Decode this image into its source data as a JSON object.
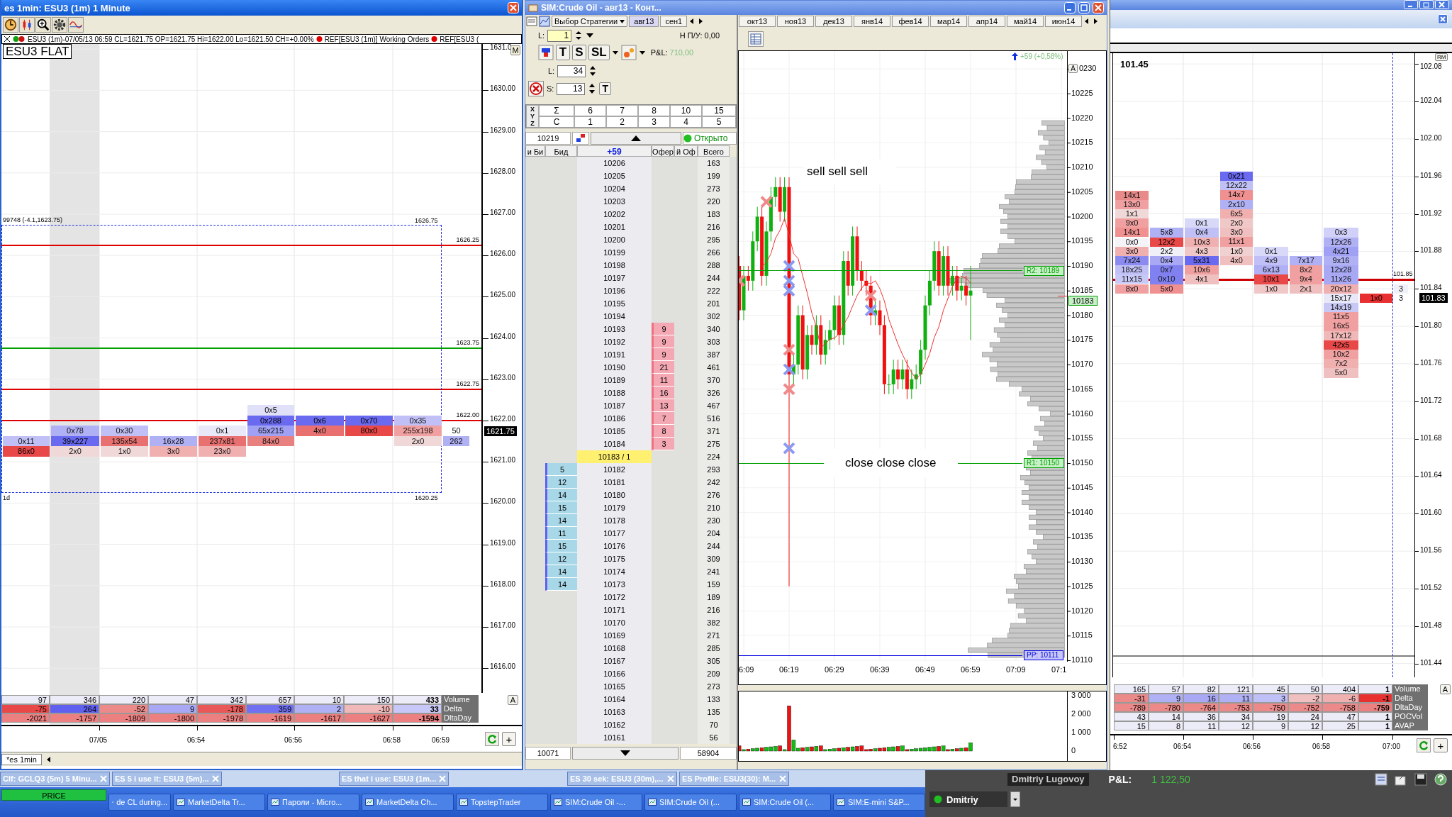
{
  "left_window": {
    "title": "es 1min: ESU3 (1m) 1 Minute",
    "info_line": "ESU3 (1m)-07/05/13 06:59 CL=1621.75 OP=1621.75 Hi=1622.00 Lo=1621.50 CH=+0.00%",
    "info_refs": [
      "REF[ESU3 (1m)] Working Orders",
      "REF[ESU3 ("
    ],
    "position_label": "ESU3 FLAT",
    "axis_button": "M",
    "price_axis": [
      "1631.0",
      "1630.00",
      "1629.00",
      "1628.00",
      "1627.00",
      "1626.00",
      "1625.00",
      "1624.00",
      "1623.00",
      "1622.00",
      "1621.00",
      "1620.00",
      "1619.00",
      "1618.00",
      "1617.00",
      "1616.00"
    ],
    "levels": [
      {
        "price": "1626.25",
        "color": "#e00000"
      },
      {
        "price": "1623.75",
        "color": "#00a000"
      },
      {
        "price": "1622.75",
        "color": "#e00000"
      },
      {
        "price": "1622.00",
        "color": "#e00000"
      }
    ],
    "range_box": {
      "note": "99748 (-4.1,1623.75)",
      "high": "1626.75",
      "low": "1620.25",
      "period": "1d"
    },
    "columns": [
      {
        "cells": [
          {
            "text": "0x11",
            "color": "#c0c0f6"
          },
          {
            "text": "86x0",
            "color": "#e84848"
          }
        ]
      },
      {
        "cells": [
          {
            "text": "0x78",
            "color": "#b0b0f4"
          },
          {
            "text": "39x227",
            "color": "#6a6af0"
          },
          {
            "text": "2x0",
            "color": "#f0d8d8"
          }
        ]
      },
      {
        "cells": [
          {
            "text": "0x30",
            "color": "#c0c0f6"
          },
          {
            "text": "135x54",
            "color": "#e87070"
          },
          {
            "text": "1x0",
            "color": "#f0d8d8"
          }
        ]
      },
      {
        "cells": [
          {
            "text": "16x28",
            "color": "#b0b0f4"
          },
          {
            "text": "3x0",
            "color": "#f0b0b0"
          }
        ]
      },
      {
        "cells": [
          {
            "text": "0x1",
            "color": "#e8e8f8"
          },
          {
            "text": "237x81",
            "color": "#e87070"
          },
          {
            "text": "23x0",
            "color": "#f0b0b0"
          }
        ]
      },
      {
        "cells": [
          {
            "text": "0x5",
            "color": "#e0e0f8"
          },
          {
            "text": "0x288",
            "color": "#6a6af0"
          },
          {
            "text": "65x215",
            "color": "#a0a0f4"
          },
          {
            "text": "84x0",
            "color": "#e88080"
          }
        ]
      },
      {
        "cells": [
          {
            "text": "0x6",
            "color": "#6a6af0"
          },
          {
            "text": "4x0",
            "color": "#e87070"
          }
        ]
      },
      {
        "cells": [
          {
            "text": "0x70",
            "color": "#6a6af0"
          },
          {
            "text": "80x0",
            "color": "#e84848"
          }
        ]
      },
      {
        "cells": [
          {
            "text": "0x35",
            "color": "#c0c0f6"
          },
          {
            "text": "255x198",
            "color": "#f0a0a0"
          },
          {
            "text": "2x0",
            "color": "#f0d8d8"
          }
        ]
      },
      {
        "cells": [
          {
            "text": "50",
            "color": "#ffffff"
          },
          {
            "text": "262",
            "color": "#b0b0f4"
          }
        ]
      }
    ],
    "last_price": "1621.75",
    "stats": [
      {
        "label": "Volume",
        "kind": "plain",
        "cells": [
          "97",
          "346",
          "220",
          "47",
          "342",
          "657",
          "10",
          "150",
          "433"
        ]
      },
      {
        "label": "Delta",
        "kind": "colored",
        "cells": [
          {
            "text": "-75",
            "color": "#e84848"
          },
          {
            "text": "264",
            "color": "#6060f0"
          },
          {
            "text": "-52",
            "color": "#ec8a8a"
          },
          {
            "text": "9",
            "color": "#a8a8f4"
          },
          {
            "text": "-178",
            "color": "#e85858"
          },
          {
            "text": "359",
            "color": "#7070f0"
          },
          {
            "text": "2",
            "color": "#b0b0f4"
          },
          {
            "text": "-10",
            "color": "#f0b8b8"
          },
          {
            "text": "33",
            "color": "#c8c8f8"
          }
        ]
      },
      {
        "label": "DltaDay",
        "kind": "colored",
        "cells": [
          {
            "text": "-2021",
            "color": "#ec8080"
          },
          {
            "text": "-1757",
            "color": "#ec8080"
          },
          {
            "text": "-1809",
            "color": "#ec8080"
          },
          {
            "text": "-1800",
            "color": "#ec8080"
          },
          {
            "text": "-1978",
            "color": "#ec8080"
          },
          {
            "text": "-1619",
            "color": "#ec8080"
          },
          {
            "text": "-1617",
            "color": "#ec8080"
          },
          {
            "text": "-1627",
            "color": "#ec8080"
          },
          {
            "text": "-1594",
            "color": "#ec8080"
          }
        ]
      }
    ],
    "auto_button": "A",
    "time_axis": [
      "07/05",
      "06:54",
      "06:56",
      "06:58",
      "06:59"
    ],
    "add_button": "+",
    "tab": "*es 1min"
  },
  "crude_window": {
    "title": "SIM:Crude Oil - авг13 - Конт...",
    "strategy": "Выбор Стратегии",
    "contract_tabs": [
      {
        "label": "авг13",
        "selected": true
      },
      {
        "label": "сен1",
        "selected": false
      }
    ],
    "lots_label": "L:",
    "lots": "1",
    "pl_open": "Н П/У: 0,00",
    "pl_label": "P&L:",
    "pl_value": "710,00",
    "order_buttons": [
      "T",
      "S",
      "SL"
    ],
    "limit_label": "L:",
    "limit": "34",
    "stop_label": "S:",
    "stop": "13",
    "t_button": "T",
    "grid": {
      "row_labels": [
        "X",
        "Y",
        "Z"
      ],
      "row1": [
        "Σ",
        "6",
        "7",
        "8",
        "10",
        "15"
      ],
      "row2": [
        "C",
        "1",
        "2",
        "3",
        "4",
        "5"
      ]
    },
    "last": "10219",
    "status": "Открыто",
    "headers": [
      "и Би",
      "Бид",
      "+59",
      "Офер",
      "й Оф",
      "Всего"
    ],
    "rows": [
      {
        "kind": "level",
        "price": "10206",
        "volume": "163"
      },
      {
        "kind": "level",
        "price": "10205",
        "volume": "199"
      },
      {
        "kind": "level",
        "price": "10204",
        "volume": "273"
      },
      {
        "kind": "level",
        "price": "10203",
        "volume": "220"
      },
      {
        "kind": "level",
        "price": "10202",
        "volume": "183"
      },
      {
        "kind": "level",
        "price": "10201",
        "volume": "216"
      },
      {
        "kind": "level",
        "price": "10200",
        "volume": "295"
      },
      {
        "kind": "level",
        "price": "10199",
        "volume": "266"
      },
      {
        "kind": "level",
        "price": "10198",
        "volume": "288"
      },
      {
        "kind": "level",
        "price": "10197",
        "volume": "244"
      },
      {
        "kind": "level",
        "price": "10196",
        "volume": "222"
      },
      {
        "kind": "level",
        "price": "10195",
        "volume": "201"
      },
      {
        "kind": "level",
        "price": "10194",
        "volume": "302"
      },
      {
        "kind": "level",
        "price": "10193",
        "offer": "9",
        "volume": "340"
      },
      {
        "kind": "level",
        "price": "10192",
        "offer": "9",
        "volume": "303"
      },
      {
        "kind": "level",
        "price": "10191",
        "offer": "9",
        "volume": "387"
      },
      {
        "kind": "level",
        "price": "10190",
        "offer": "21",
        "volume": "461"
      },
      {
        "kind": "level",
        "price": "10189",
        "offer": "11",
        "volume": "370"
      },
      {
        "kind": "level",
        "price": "10188",
        "offer": "16",
        "volume": "326"
      },
      {
        "kind": "level",
        "price": "10187",
        "offer": "13",
        "volume": "467"
      },
      {
        "kind": "level",
        "price": "10186",
        "offer": "7",
        "volume": "516"
      },
      {
        "kind": "level",
        "price": "10185",
        "offer": "8",
        "volume": "371"
      },
      {
        "kind": "level",
        "price": "10184",
        "offer": "3",
        "volume": "275"
      },
      {
        "kind": "last",
        "price": "10183 / 1",
        "volume": "224"
      },
      {
        "kind": "level",
        "price": "10182",
        "bid": "5",
        "volume": "293"
      },
      {
        "kind": "level",
        "price": "10181",
        "bid": "12",
        "volume": "242"
      },
      {
        "kind": "level",
        "price": "10180",
        "bid": "14",
        "volume": "276"
      },
      {
        "kind": "level",
        "price": "10179",
        "bid": "15",
        "volume": "210"
      },
      {
        "kind": "level",
        "price": "10178",
        "bid": "14",
        "volume": "230"
      },
      {
        "kind": "level",
        "price": "10177",
        "bid": "11",
        "volume": "204"
      },
      {
        "kind": "level",
        "price": "10176",
        "bid": "15",
        "volume": "244"
      },
      {
        "kind": "level",
        "price": "10175",
        "bid": "12",
        "volume": "309"
      },
      {
        "kind": "level",
        "price": "10174",
        "bid": "14",
        "volume": "241"
      },
      {
        "kind": "level",
        "price": "10173",
        "bid": "14",
        "volume": "159"
      },
      {
        "kind": "level",
        "price": "10172",
        "volume": "189"
      },
      {
        "kind": "level",
        "price": "10171",
        "volume": "216"
      },
      {
        "kind": "level",
        "price": "10170",
        "volume": "382"
      },
      {
        "kind": "level",
        "price": "10169",
        "volume": "271"
      },
      {
        "kind": "level",
        "price": "10168",
        "volume": "285"
      },
      {
        "kind": "level",
        "price": "10167",
        "volume": "305"
      },
      {
        "kind": "level",
        "price": "10166",
        "volume": "209"
      },
      {
        "kind": "level",
        "price": "10165",
        "volume": "273"
      },
      {
        "kind": "level",
        "price": "10164",
        "volume": "133"
      },
      {
        "kind": "level",
        "price": "10163",
        "volume": "135"
      },
      {
        "kind": "level",
        "price": "10162",
        "volume": "70"
      },
      {
        "kind": "level",
        "price": "10161",
        "volume": "56"
      }
    ],
    "footer": {
      "low": "10071",
      "total": "58904"
    },
    "month_tabs": [
      "окт13",
      "ноя13",
      "дек13",
      "янв14",
      "фев14",
      "мар14",
      "апр14",
      "май14",
      "июн14"
    ],
    "change": "+59 (+0,58%)",
    "axis_button": "A",
    "annotations": [
      "sell sell sell",
      "close close close"
    ],
    "levels": [
      {
        "label": "R2: 10189",
        "color": "#00a000"
      },
      {
        "label": "R1: 10150",
        "color": "#00a000"
      },
      {
        "label": "PP: 10111",
        "color": "#0000e0"
      }
    ],
    "last_price": "10183",
    "price_axis": [
      "0230",
      "10225",
      "10220",
      "10215",
      "10210",
      "10205",
      "10200",
      "10195",
      "10190",
      "10185",
      "10180",
      "10175",
      "10170",
      "10165",
      "10160",
      "10155",
      "10150",
      "10145",
      "10140",
      "10135",
      "10130",
      "10125",
      "10120",
      "10115",
      "10110"
    ],
    "time_axis": [
      "6:09",
      "06:19",
      "06:29",
      "06:39",
      "06:49",
      "06:59",
      "07:09",
      "07:1"
    ],
    "volume_axis": [
      "3 000",
      "2 000",
      "1 000",
      "0"
    ]
  },
  "right_window": {
    "last_label": "101.45",
    "axis_button": "RM",
    "price_axis": [
      "102.08",
      "102.04",
      "102.00",
      "101.96",
      "101.92",
      "101.88",
      "101.84",
      "101.80",
      "101.76",
      "101.72",
      "101.68",
      "101.64",
      "101.60",
      "101.56",
      "101.52",
      "101.48",
      "101.44"
    ],
    "level": {
      "price": "101.85",
      "color": "#cc0000"
    },
    "columns": [
      {
        "cells": [
          {
            "text": "14x1",
            "color": "#e88a8a"
          },
          {
            "text": "13x0",
            "color": "#f0a0a0"
          },
          {
            "text": "1x1",
            "color": "#f0d8d8"
          },
          {
            "text": "9x0",
            "color": "#f0a0a0"
          },
          {
            "text": "14x1",
            "color": "#f09090"
          },
          {
            "text": "0x0",
            "color": "#f4f4f8"
          },
          {
            "text": "3x0",
            "color": "#f0b0b0"
          },
          {
            "text": "7x24",
            "color": "#8a8af0"
          },
          {
            "text": "18x25",
            "color": "#c0c0f6"
          },
          {
            "text": "11x15",
            "color": "#c8c8f6"
          },
          {
            "text": "8x0",
            "color": "#f0a0a0"
          }
        ]
      },
      {
        "cells": [
          {
            "text": "5x8",
            "color": "#b0b0f4"
          },
          {
            "text": "12x2",
            "color": "#e84848"
          },
          {
            "text": "2x2",
            "color": "#f0f0f8"
          },
          {
            "text": "0x4",
            "color": "#a8a8f4"
          },
          {
            "text": "0x7",
            "color": "#8080f0"
          },
          {
            "text": "0x10",
            "color": "#8080f0"
          },
          {
            "text": "5x0",
            "color": "#f09090"
          }
        ]
      },
      {
        "cells": [
          {
            "text": "0x1",
            "color": "#d8d8f8"
          },
          {
            "text": "0x4",
            "color": "#c0c0f6"
          },
          {
            "text": "10x3",
            "color": "#f0b0b0"
          },
          {
            "text": "4x3",
            "color": "#f0c8c8"
          },
          {
            "text": "5x31",
            "color": "#6a6af0"
          },
          {
            "text": "10x6",
            "color": "#f0a0a0"
          },
          {
            "text": "4x1",
            "color": "#f0c0c0"
          }
        ]
      },
      {
        "cells": [
          {
            "text": "0x21",
            "color": "#6a6af0"
          },
          {
            "text": "12x22",
            "color": "#c0c0f6"
          },
          {
            "text": "14x7",
            "color": "#f09090"
          },
          {
            "text": "2x10",
            "color": "#b0b0f4"
          },
          {
            "text": "6x5",
            "color": "#f0b0b0"
          },
          {
            "text": "2x0",
            "color": "#f0c8c8"
          },
          {
            "text": "3x0",
            "color": "#f0c0c0"
          },
          {
            "text": "11x1",
            "color": "#f0a0a0"
          },
          {
            "text": "1x0",
            "color": "#f0d0d0"
          },
          {
            "text": "4x0",
            "color": "#f0c0c0"
          }
        ]
      },
      {
        "cells": [
          {
            "text": "0x1",
            "color": "#d8d8f8"
          },
          {
            "text": "4x9",
            "color": "#c0c0f6"
          },
          {
            "text": "6x13",
            "color": "#b0b0f4"
          },
          {
            "text": "10x1",
            "color": "#e84848"
          },
          {
            "text": "1x0",
            "color": "#f0c8c8"
          }
        ]
      },
      {
        "cells": [
          {
            "text": "7x17",
            "color": "#b0b0f4"
          },
          {
            "text": "8x2",
            "color": "#f0a0a0"
          },
          {
            "text": "9x4",
            "color": "#f0a0a0"
          },
          {
            "text": "2x1",
            "color": "#f0c0c0"
          }
        ]
      },
      {
        "cells": [
          {
            "text": "0x3",
            "color": "#d0d0f8"
          },
          {
            "text": "12x26",
            "color": "#b0b0f4"
          },
          {
            "text": "4x21",
            "color": "#a0a0f4"
          },
          {
            "text": "9x16",
            "color": "#b0b0f4"
          },
          {
            "text": "12x28",
            "color": "#a8a8f4"
          },
          {
            "text": "11x26",
            "color": "#a8a8f4"
          },
          {
            "text": "20x12",
            "color": "#f0b0b0"
          },
          {
            "text": "15x17",
            "color": "#e8e8f8"
          },
          {
            "text": "14x19",
            "color": "#c8c8f6"
          },
          {
            "text": "11x5",
            "color": "#f0a0a0"
          },
          {
            "text": "16x5",
            "color": "#f0a0a0"
          },
          {
            "text": "17x12",
            "color": "#f0b8b8"
          },
          {
            "text": "42x5",
            "color": "#e84848"
          },
          {
            "text": "10x2",
            "color": "#f0a0a0"
          },
          {
            "text": "7x2",
            "color": "#f0b0b0"
          },
          {
            "text": "5x0",
            "color": "#f0c0c0"
          }
        ]
      },
      {
        "cells": [
          {
            "text": "1x0",
            "color": "#e83030"
          }
        ]
      },
      {
        "cells": [
          {
            "text": "3",
            "color": "#f0f0f8"
          },
          {
            "text": "3",
            "color": "#ffffff"
          }
        ]
      }
    ],
    "last_price": "101.83",
    "stats": [
      {
        "label": "Volume",
        "kind": "plain",
        "cells": [
          "165",
          "57",
          "82",
          "121",
          "45",
          "50",
          "404",
          "1"
        ]
      },
      {
        "label": "Delta",
        "kind": "colored",
        "cells": [
          {
            "text": "-31",
            "color": "#ec8a8a"
          },
          {
            "text": "9",
            "color": "#b0b0f4"
          },
          {
            "text": "16",
            "color": "#a8a8f4"
          },
          {
            "text": "11",
            "color": "#b0b0f4"
          },
          {
            "text": "3",
            "color": "#c0c0f8"
          },
          {
            "text": "-2",
            "color": "#f0c0c0"
          },
          {
            "text": "-6",
            "color": "#f0b0b0"
          },
          {
            "text": "-1",
            "color": "#e83030"
          }
        ]
      },
      {
        "label": "DltaDay",
        "kind": "colored",
        "cells": [
          {
            "text": "-789",
            "color": "#ec8a8a"
          },
          {
            "text": "-780",
            "color": "#ec8a8a"
          },
          {
            "text": "-764",
            "color": "#ec8a8a"
          },
          {
            "text": "-753",
            "color": "#ec8a8a"
          },
          {
            "text": "-750",
            "color": "#ec8a8a"
          },
          {
            "text": "-752",
            "color": "#ec8a8a"
          },
          {
            "text": "-758",
            "color": "#ec8a8a"
          },
          {
            "text": "-759",
            "color": "#ec8080"
          }
        ]
      },
      {
        "label": "POCVol",
        "kind": "plain",
        "cells": [
          "43",
          "14",
          "36",
          "34",
          "19",
          "24",
          "47",
          "1"
        ]
      },
      {
        "label": "AVAP",
        "kind": "plain",
        "cells": [
          "15",
          "8",
          "11",
          "12",
          "9",
          "12",
          "25",
          "1"
        ]
      }
    ],
    "auto_button": "A",
    "time_axis": [
      "6:52",
      "06:54",
      "06:56",
      "06:58",
      "07:00"
    ],
    "add_button": "+"
  },
  "bottom": {
    "chart_tabs": [
      "Clf: GCLQ3 (5m) 5 Minu...",
      "ES 5 i use it: ESU3 (5m)...",
      "ES that i use: ESU3 (1m...",
      "ES 30 sek: ESU3 (30m),...",
      "ES Profile: ESU3(30): M..."
    ],
    "price_button": "PRICE",
    "taskbar": [
      "de CL during...",
      "MarketDelta Tr...",
      "Пароли - Micro...",
      "MarketDelta Ch...",
      "TopstepTrader",
      "SIM:Crude Oil -...",
      "SIM:Crude Oil (...",
      "SIM:Crude Oil (...",
      "SIM:E-mini S&P..."
    ],
    "account": {
      "user": "Dmitriy Lugovoy",
      "pl_label": "P&L:",
      "pl_value": "1 122,50",
      "login": "Dmitriy"
    }
  }
}
